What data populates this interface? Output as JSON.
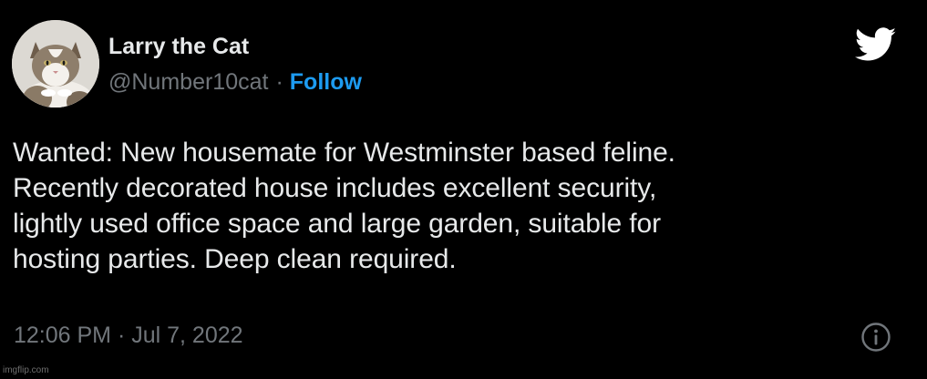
{
  "tweet": {
    "author": {
      "display_name": "Larry the Cat",
      "handle": "@Number10cat",
      "separator": "·",
      "follow_label": "Follow",
      "avatar_icon": "cat-avatar"
    },
    "brand_icon": "twitter-bird-icon",
    "text": "Wanted: New housemate for Westminster based feline.\nRecently decorated house includes excellent security,\nlightly used office space and large garden, suitable for\nhosting parties. Deep clean required.",
    "timestamp": "12:06 PM · Jul 7, 2022",
    "info_icon": "info-icon"
  },
  "watermark": "imgflip.com",
  "colors": {
    "background": "#000000",
    "primary_text": "#e7e9ea",
    "secondary_text": "#71767b",
    "accent": "#1d9bf0"
  }
}
